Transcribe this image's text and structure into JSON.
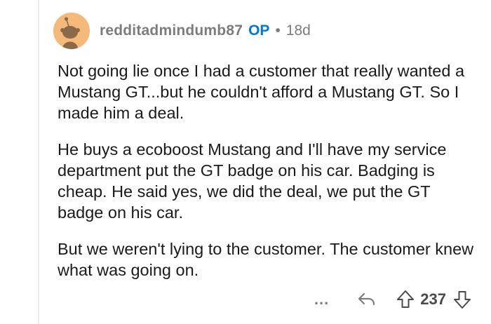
{
  "comment": {
    "author": "redditadmindumb87",
    "op_label": "OP",
    "separator": "•",
    "age": "18d",
    "avatar_icon": "snoo-avatar-icon",
    "paragraphs": [
      "Not going lie once I had a customer that really wanted a Mustang GT...but he couldn't afford a Mustang GT. So I made him a deal.",
      "He buys a ecoboost Mustang and I'll have my service department put the GT badge on his car. Badging is cheap. He said yes, we did the deal, we put the GT badge on his car.",
      "But we weren't lying to the customer. The customer knew what was going on."
    ],
    "actions": {
      "more_label": "...",
      "reply_icon": "reply-icon",
      "upvote_icon": "upvote-arrow-icon",
      "vote_count": "237",
      "downvote_icon": "downvote-arrow-icon"
    }
  },
  "colors": {
    "avatar_bg": "#f5b97a",
    "username": "#7c7c7c",
    "op_badge": "#0079d3",
    "body_text": "#1a1a1b"
  }
}
